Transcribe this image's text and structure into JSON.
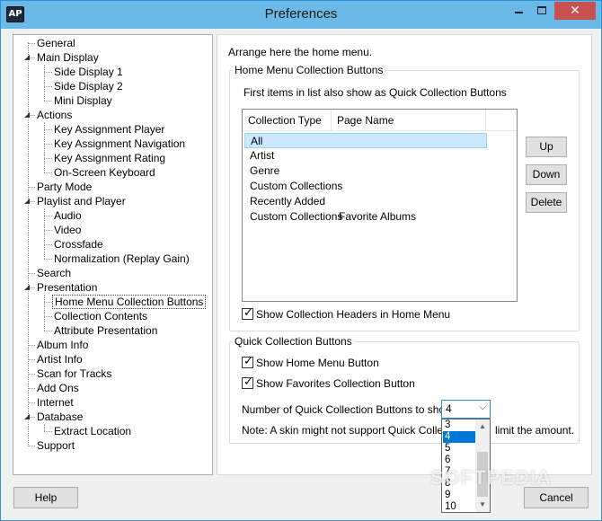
{
  "window": {
    "app_icon_text": "AP",
    "title": "Preferences",
    "minimize_glyph": "",
    "close_glyph": "✕"
  },
  "tree": {
    "items": [
      {
        "label": "General"
      },
      {
        "label": "Main Display"
      },
      {
        "label": "Side Display 1"
      },
      {
        "label": "Side Display 2"
      },
      {
        "label": "Mini Display"
      },
      {
        "label": "Actions"
      },
      {
        "label": "Key Assignment Player"
      },
      {
        "label": "Key Assignment Navigation"
      },
      {
        "label": "Key Assignment Rating"
      },
      {
        "label": "On-Screen Keyboard"
      },
      {
        "label": "Party Mode"
      },
      {
        "label": "Playlist and Player"
      },
      {
        "label": "Audio"
      },
      {
        "label": "Video"
      },
      {
        "label": "Crossfade"
      },
      {
        "label": "Normalization (Replay Gain)"
      },
      {
        "label": "Search"
      },
      {
        "label": "Presentation"
      },
      {
        "label": "Home Menu Collection Buttons"
      },
      {
        "label": "Collection Contents"
      },
      {
        "label": "Attribute Presentation"
      },
      {
        "label": "Album Info"
      },
      {
        "label": "Artist Info"
      },
      {
        "label": "Scan for Tracks"
      },
      {
        "label": "Add Ons"
      },
      {
        "label": "Internet"
      },
      {
        "label": "Database"
      },
      {
        "label": "Extract Location"
      },
      {
        "label": "Support"
      }
    ],
    "expander_glyph": "◢"
  },
  "panel": {
    "intro": "Arrange here the home menu.",
    "home_menu_group": {
      "title": "Home Menu Collection Buttons",
      "hint": "First items in list also show as Quick Collection Buttons",
      "columns": [
        "Collection Type",
        "Page Name"
      ],
      "rows": [
        {
          "type": "All",
          "page": ""
        },
        {
          "type": "Artist",
          "page": ""
        },
        {
          "type": "Genre",
          "page": ""
        },
        {
          "type": "Custom Collections",
          "page": ""
        },
        {
          "type": "Recently Added",
          "page": ""
        },
        {
          "type": "Custom Collections",
          "page": "Favorite Albums"
        }
      ],
      "up_label": "Up",
      "down_label": "Down",
      "delete_label": "Delete",
      "show_headers_label": "Show Collection Headers in Home Menu",
      "show_headers_checked": true
    },
    "quick_group": {
      "title": "Quick Collection Buttons",
      "show_home_menu_button_label": "Show Home Menu Button",
      "show_home_menu_button_checked": true,
      "show_favorites_label": "Show Favorites Collection Button",
      "show_favorites_checked": true,
      "count_label": "Number of Quick Collection Buttons to show:",
      "count_value": "4",
      "count_options": [
        "3",
        "4",
        "5",
        "6",
        "7",
        "8",
        "9",
        "10"
      ],
      "note_prefix": "Note: A skin might not support Quick Collection",
      "note_suffix": "limit the amount."
    }
  },
  "footer": {
    "help_label": "Help",
    "cancel_label": "Cancel"
  },
  "glyphs": {
    "check": "✓",
    "dropdown_arrow": "⌵",
    "scroll_up": "▲",
    "scroll_down": "▼"
  },
  "watermark": "SOFTPEDIA"
}
